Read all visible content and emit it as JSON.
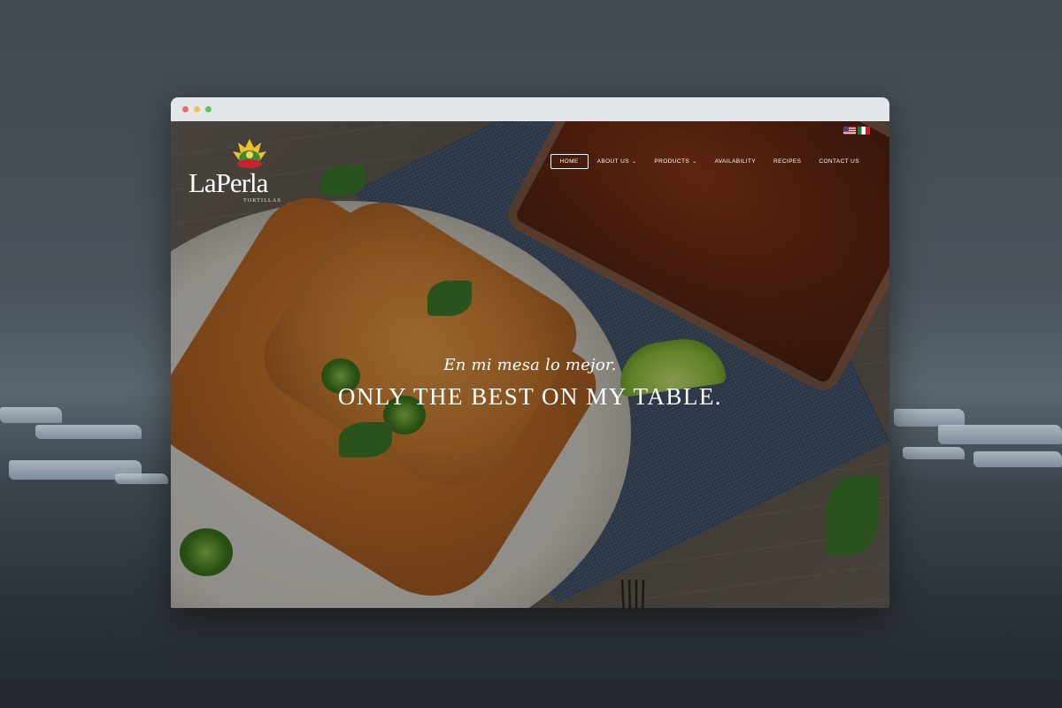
{
  "browser": {
    "controls": [
      "close",
      "minimize",
      "maximize"
    ]
  },
  "site": {
    "logo": {
      "name": "LaPerla",
      "sub": "TORTILLAS"
    },
    "languages": [
      {
        "icon": "flag-us-icon"
      },
      {
        "icon": "flag-mx-icon"
      }
    ],
    "nav": [
      {
        "label": "HOME",
        "active": true,
        "dropdown": false
      },
      {
        "label": "ABOUT US",
        "active": false,
        "dropdown": true
      },
      {
        "label": "PRODUCTS",
        "active": false,
        "dropdown": true
      },
      {
        "label": "AVAILABILITY",
        "active": false,
        "dropdown": false
      },
      {
        "label": "RECIPES",
        "active": false,
        "dropdown": false
      },
      {
        "label": "CONTACT US",
        "active": false,
        "dropdown": false
      }
    ],
    "hero": {
      "tagline": "En mi mesa lo mejor.",
      "title": "ONLY THE BEST ON MY TABLE."
    }
  },
  "colors": {
    "browser_chrome": "#e3e6ea",
    "close": "#ef6a5e",
    "minimize": "#f4be4f",
    "maximize": "#5dc355",
    "text": "#ffffff"
  }
}
